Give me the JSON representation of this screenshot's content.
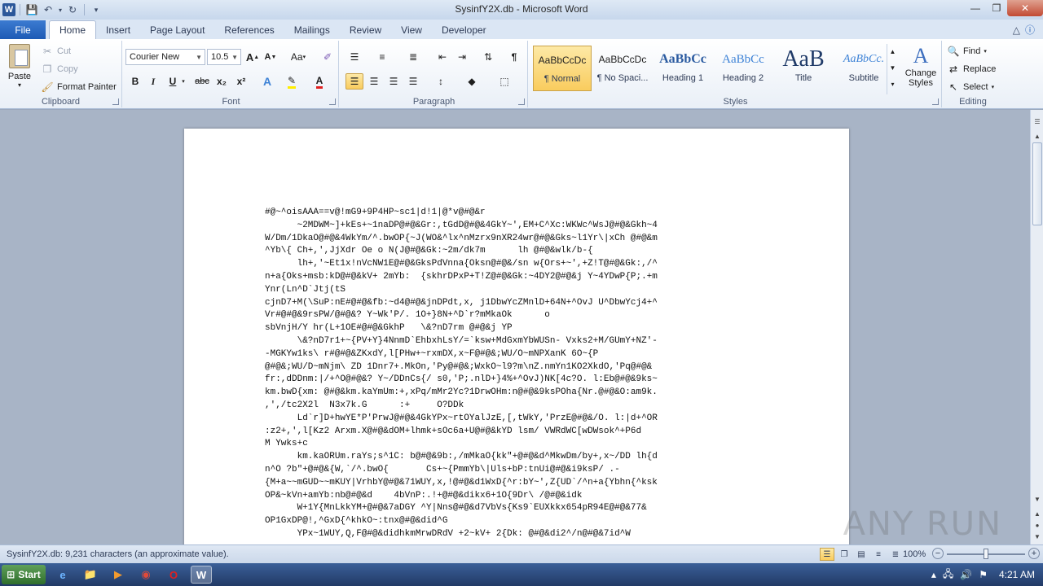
{
  "window": {
    "title": "SysinfY2X.db - Microsoft Word"
  },
  "tabs": {
    "file": "File",
    "items": [
      "Home",
      "Insert",
      "Page Layout",
      "References",
      "Mailings",
      "Review",
      "View",
      "Developer"
    ],
    "active": "Home"
  },
  "ribbon": {
    "clipboard": {
      "paste": "Paste",
      "cut": "Cut",
      "copy": "Copy",
      "format_painter": "Format Painter",
      "label": "Clipboard"
    },
    "font": {
      "name": "Courier New",
      "size": "10.5",
      "label": "Font",
      "bold": "B",
      "italic": "I",
      "underline": "U",
      "strike": "abc",
      "sub": "x₂",
      "sup": "x²",
      "grow": "A",
      "shrink": "A",
      "case": "Aa"
    },
    "paragraph": {
      "label": "Paragraph"
    },
    "styles": {
      "label": "Styles",
      "items": [
        {
          "preview": "AaBbCcDc",
          "name": "¶ Normal"
        },
        {
          "preview": "AaBbCcDc",
          "name": "¶ No Spaci..."
        },
        {
          "preview": "AaBbCc",
          "name": "Heading 1"
        },
        {
          "preview": "AaBbCc",
          "name": "Heading 2"
        },
        {
          "preview": "AaB",
          "name": "Title"
        },
        {
          "preview": "AaBbCc.",
          "name": "Subtitle"
        }
      ],
      "change_styles": "Change Styles"
    },
    "editing": {
      "label": "Editing",
      "find": "Find",
      "replace": "Replace",
      "select": "Select"
    }
  },
  "document": {
    "lines": [
      "#@~^oisAAA==v@!mG9+9P4HP~sc1|d!1|@*v@#@&r",
      "      ~2MDWM~]+kEs+~1naDP@#@&Gr:,tGdD@#@&4GkY~',EM+C^Xc:WKWc^WsJ@#@&Gkh~4",
      "W/Dm/1DkaO@#@&4WkYm/^.bwOP{~J(WO&^lx^nMzrx9nXR24wr@#@&Gks~l1Yr\\|xCh @#@&m",
      "^Yb\\{ Ch+,',JjXdr Oe o N(J@#@&Gk:~2m/dk7m      lh @#@&wlk/b-{",
      "      lh+,'~Et1x!nVcNW1E@#@&GksPdVnna{Oksn@#@&/sn w{Ors+~',+Z!T@#@&Gk:,/^",
      "n+a{Oks+msb:kD@#@&kV+ 2mYb:  {skhrDPxP+T!Z@#@&Gk:~4DY2@#@&j Y~4YDwP{P;.+m",
      "Ynr(Ln^D`Jtj(tS",
      "cjnD7+M(\\SuP:nE#@#@&fb:~d4@#@&jnDPdt,x, j1DbwYcZMnlD+64N+^OvJ U^DbwYcj4+^",
      "Vr#@#@&9rsPW/@#@&? Y~Wk'P/. 1O+}8N+^D`r?mMkaOk      o",
      "sbVnjH/Y hr(L+1OE#@#@&GkhP   \\&?nD7rm @#@&j YP",
      "      \\&?nD7r1+~{PV+Y}4NnmD`EhbxhLsY/=`ksw+MdGxmYbWUSn- Vxks2+M/GUmY+NZ'-",
      "-MGKYw1ks\\ r#@#@&ZKxdY,l[PHw+~rxmDX,x~F@#@&;WU/O~mNPXanK 6O~{P",
      "@#@&;WU/D~mNjm\\ ZD 1Dnr7+.MkOn,'Py@#@&;WxkO~l9?m\\nZ.nmYn1KO2XkdO,'Pq@#@&",
      "fr:,dDDnm:|/+^O@#@&? Y~/DDnCs{/ s0,'P;.nlD+}4%+^OvJ)NK[4c?O. l:Eb@#@&9ks~",
      "km.bwD{xm: @#@&km.kaYmUm:+,xPq/mMr2Yc?1DrwOHm:n@#@&9ksPOha{Nr.@#@&O:am9k.",
      ",',/tc2X2l  N3x7k.G      :+     O?DDk",
      "      Ld`r]D+hwYE*P'PrwJ@#@&4GkYPx~rtOYalJzE,[,tWkY,'PrzE@#@&/O. l:|d+^OR",
      ":z2+,',l[Kz2 Arxm.X@#@&dOM+lhmk+sOc6a+U@#@&kYD lsm/ VWRdWC[wDWsok^+P6d",
      "M Ywks+c",
      "      km.kaORUm.raYs;s^1C: b@#@&9b:,/mMkaO{kk\"+@#@&d^MkwDm/by+,x~/DD lh{d",
      "n^O ?b\"+@#@&{W,`/^.bwO{       Cs+~{PmmYb\\|Uls+bP:tnUi@#@&i9ksP/ .-",
      "{M+a~~mGUD~~mKUY|VrhbY@#@&71WUY,x,!@#@&d1WxD{^r:bY~',Z{UD`/^n+a{Ybhn{^ksk",
      "OP&~kVn+amYb:nb@#@&d    4bVnP:.!+@#@&dikx6+1O{9Dr\\ /@#@&idk",
      "      W+1Y{MnLkkYM+@#@&7aDGY ^Y|Nns@#@&d7VbVs{Ks9`EUXkkx654pR94E@#@&77&",
      "OP1GxDP@!,^GxD{^khkO~:tnx@#@&did^G",
      "      YPx~1WUY,Q,F@#@&didhkmMrwDRdV +2~kV+ 2{Dk: @#@&di2^/n@#@&7id^W"
    ]
  },
  "statusbar": {
    "message": "SysinfY2X.db: 9,231 characters (an approximate value).",
    "zoom": "100%",
    "zoom_level": 1.0
  },
  "taskbar": {
    "start": "Start",
    "clock": "4:21 AM"
  },
  "watermark": "ANY RUN"
}
